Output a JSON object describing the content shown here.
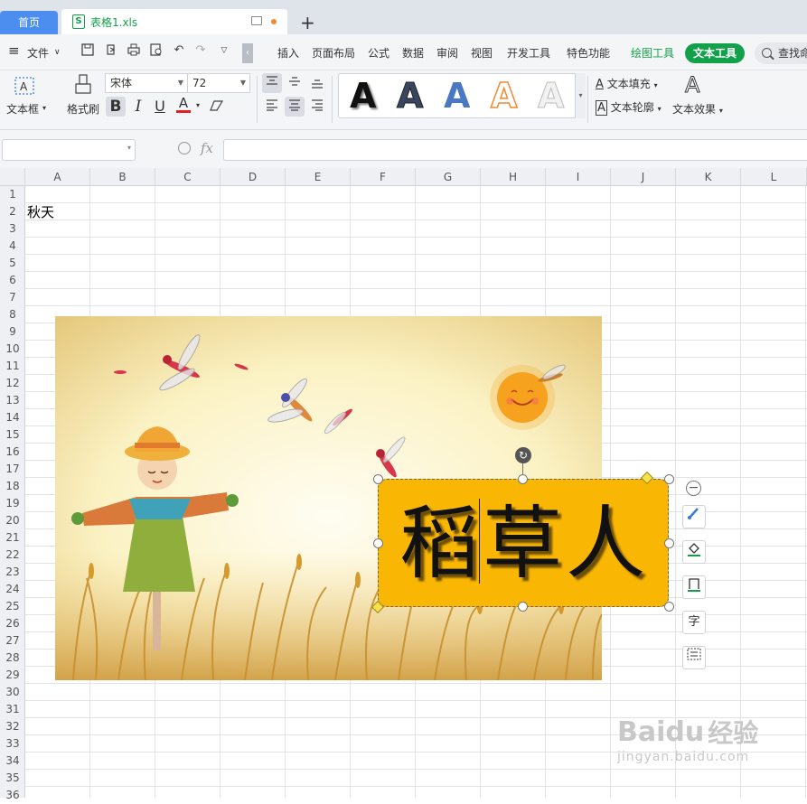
{
  "tabs": {
    "home": "首页",
    "file": "表格1.xls"
  },
  "menu": {
    "file": "文件",
    "items": [
      "插入",
      "页面布局",
      "公式",
      "数据",
      "审阅",
      "视图",
      "开发工具",
      "特色功能"
    ],
    "drawing_tools": "绘图工具",
    "text_tools": "文本工具",
    "search": "查找命"
  },
  "ribbon": {
    "textbox": "文本框",
    "format_painter": "格式刷",
    "font_name": "宋体",
    "font_size": "72",
    "bold": "B",
    "italic": "I",
    "underline": "U",
    "font_color": "A",
    "text_fill": "文本填充",
    "text_outline": "文本轮廓",
    "text_effect": "文本效果",
    "style_letter": "A"
  },
  "formula_bar": {
    "fx": "fx"
  },
  "columns": [
    "A",
    "B",
    "C",
    "D",
    "E",
    "F",
    "G",
    "H",
    "I",
    "J",
    "K",
    "L"
  ],
  "rows": [
    "1",
    "2",
    "3",
    "4",
    "5",
    "6",
    "7",
    "8",
    "9",
    "10",
    "11",
    "12",
    "13",
    "14",
    "15",
    "16",
    "17",
    "18",
    "19",
    "20",
    "21",
    "22",
    "23",
    "24",
    "25",
    "26",
    "27",
    "28",
    "29",
    "30",
    "31",
    "32",
    "33",
    "34",
    "35",
    "36"
  ],
  "cells": {
    "A2": "秋天"
  },
  "textbox": {
    "text": "稻草人",
    "fill_color": "#f9b602"
  },
  "side_tools": {
    "text_direction": "字"
  },
  "watermark": {
    "brand": "Baidu",
    "brand_cn": "经验",
    "url": "jingyan.baidu.com"
  },
  "colors": {
    "accent_green": "#13a04b",
    "home_tab": "#4b8ef0"
  }
}
